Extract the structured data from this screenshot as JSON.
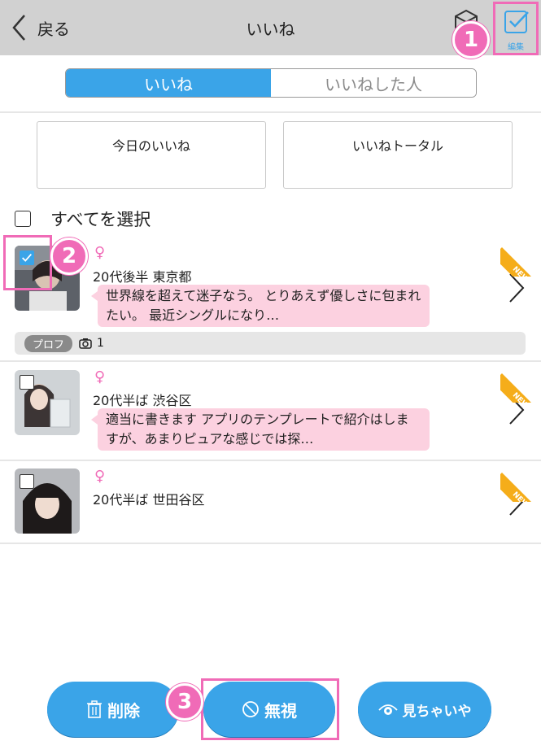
{
  "header": {
    "back_label": "戻る",
    "title": "いいね",
    "edit_label": "編集"
  },
  "tabs": [
    {
      "label": "いいね",
      "active": true
    },
    {
      "label": "いいねした人",
      "active": false
    }
  ],
  "cards": [
    {
      "label": "今日のいいね"
    },
    {
      "label": "いいねトータル"
    }
  ],
  "select_all": {
    "label": "すべてを選択",
    "checked": false
  },
  "users": [
    {
      "gender": "♀",
      "meta": "20代後半 東京都",
      "message": "世界線を超えて迷子なう。 とりあえず優しさに包まれたい。 最近シングルになり…",
      "checked": true,
      "is_new": true,
      "new_label": "NEW",
      "profile_label": "プロフ",
      "photo_count": "1"
    },
    {
      "gender": "♀",
      "meta": "20代半ば 渋谷区",
      "message": "適当に書きます アプリのテンプレートで紹介はしますが、あまりピュアな感じでは探…",
      "checked": false,
      "is_new": true,
      "new_label": "NEW"
    },
    {
      "gender": "♀",
      "meta": "20代半ば 世田谷区",
      "checked": false,
      "is_new": true,
      "new_label": "NEW"
    }
  ],
  "step_badges": [
    "1",
    "2",
    "3"
  ],
  "actions": {
    "delete_label": "削除",
    "ignore_label": "無視",
    "seen_label": "見ちゃいや"
  },
  "colors": {
    "accent": "#3aa4e8",
    "highlight": "#f06bb7",
    "bubble": "#fcd1e0",
    "new_ribbon": "#f5ad1a",
    "header_bg": "#d1d1d1"
  }
}
